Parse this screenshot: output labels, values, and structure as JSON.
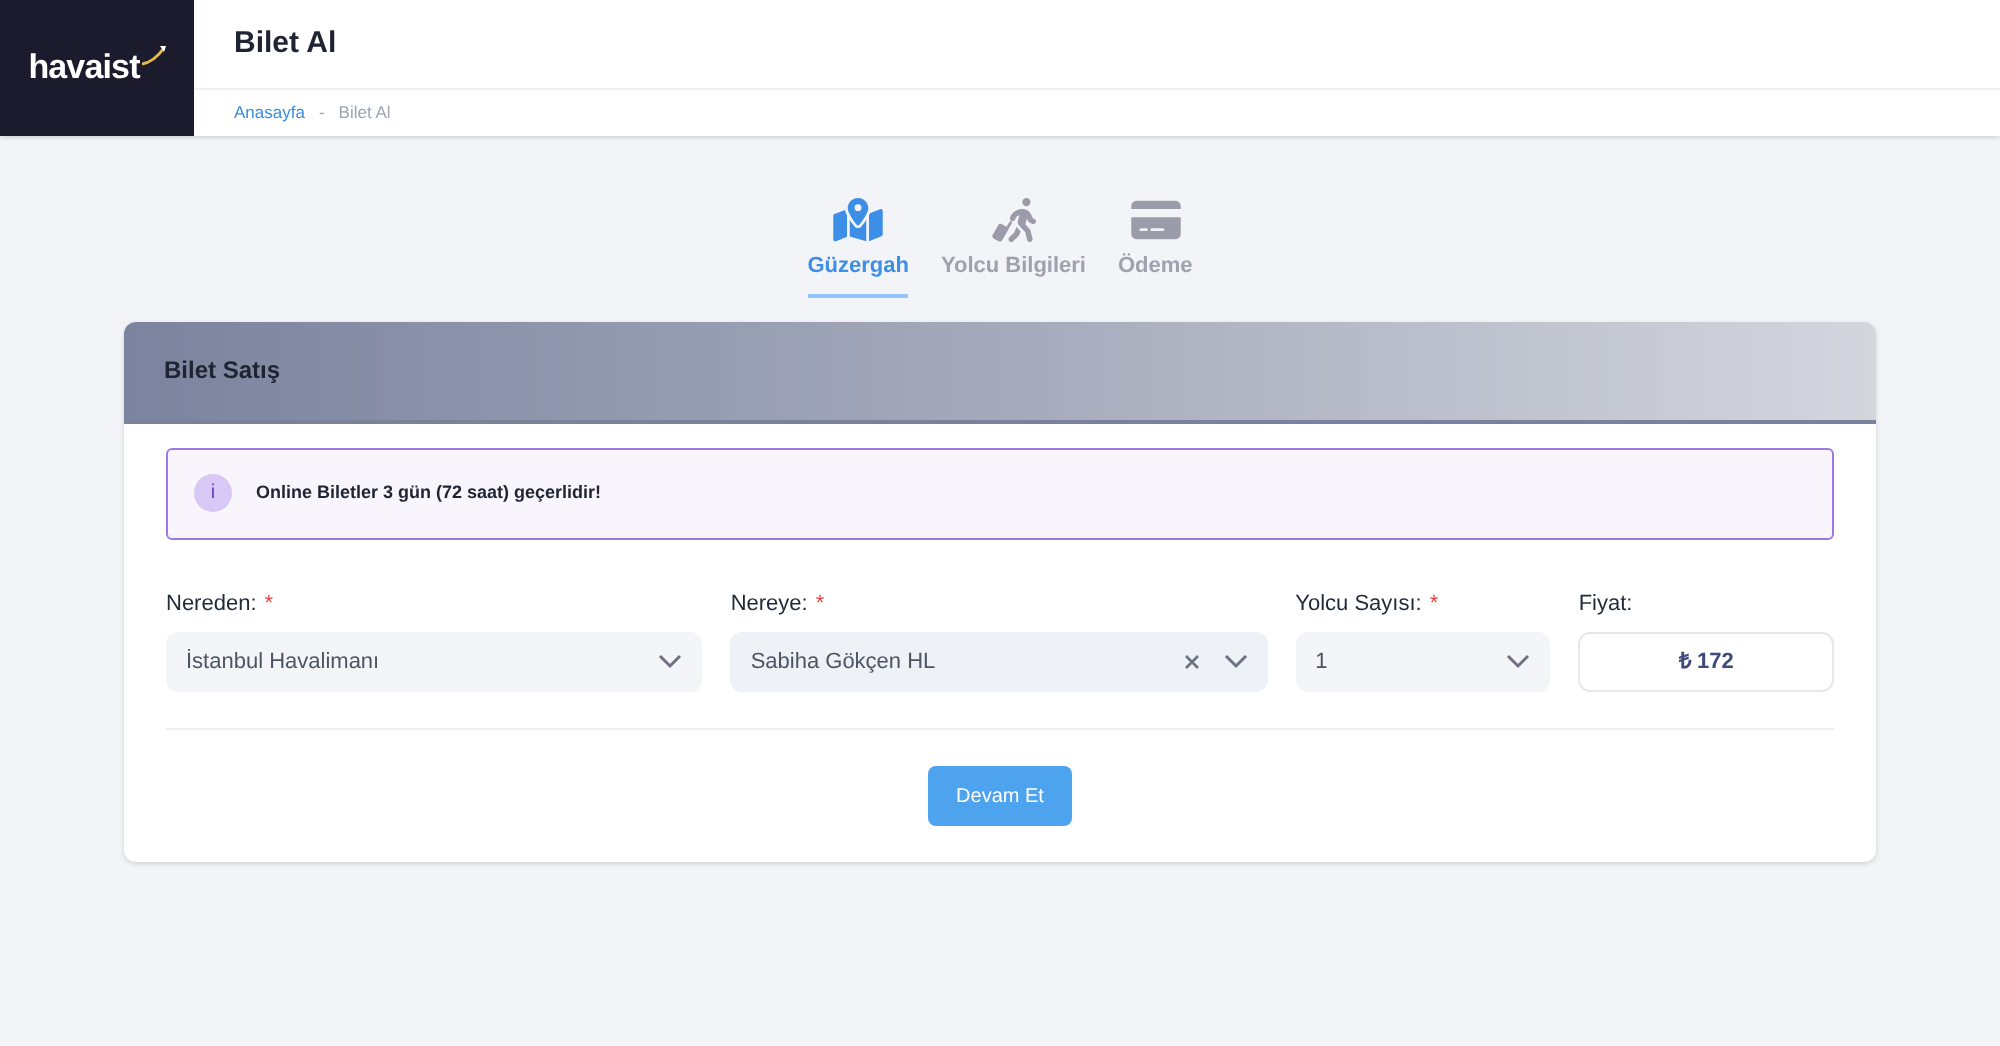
{
  "logo": {
    "text": "havaist"
  },
  "header": {
    "title": "Bilet Al"
  },
  "breadcrumb": [
    {
      "label": "Anasayfa",
      "kind": "link"
    },
    {
      "label": "-",
      "kind": "separator"
    },
    {
      "label": "Bilet Al",
      "kind": "current"
    }
  ],
  "steps": [
    {
      "label": "Güzergah",
      "kind": "map",
      "selected": true
    },
    {
      "label": "Yolcu Bilgileri",
      "kind": "traveler",
      "selected": false
    },
    {
      "label": "Ödeme",
      "kind": "card",
      "selected": false
    }
  ],
  "card": {
    "title": "Bilet Satış",
    "alert": {
      "icon_text": "i",
      "text": "Online Biletler 3 gün (72 saat) geçerlidir!"
    },
    "fields": [
      {
        "label": "Nereden:",
        "required_mark": "*",
        "kind": "select",
        "value": "İstanbul Havalimanı",
        "clearable": false
      },
      {
        "label": "Nereye:",
        "required_mark": "*",
        "kind": "select",
        "value": "Sabiha Gökçen HL",
        "clearable": true
      },
      {
        "label": "Yolcu Sayısı:",
        "required_mark": "*",
        "kind": "select",
        "value": "1",
        "clearable": false
      },
      {
        "label": "Fiyat:",
        "kind": "price",
        "value": "₺ 172"
      }
    ],
    "button": "Devam Et"
  }
}
